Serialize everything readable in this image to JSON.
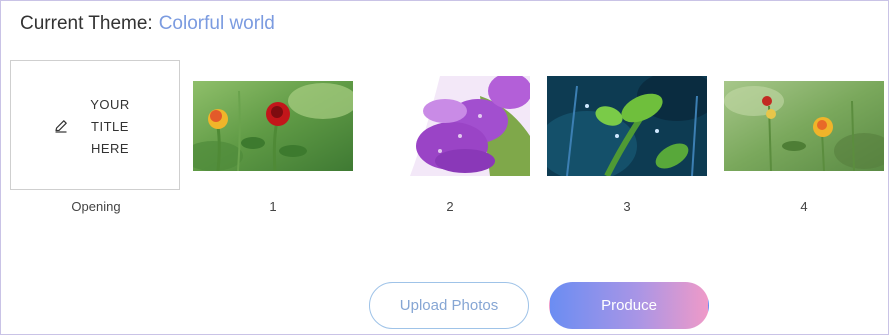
{
  "header": {
    "label": "Current Theme:",
    "theme_name": "Colorful world"
  },
  "opening": {
    "title_placeholder": "YOUR\nTITLE\nHERE",
    "caption": "Opening",
    "icon": "pencil-icon"
  },
  "photos": [
    {
      "caption": "1",
      "subject": "yellow and red roses"
    },
    {
      "caption": "2",
      "subject": "purple tulips with droplets"
    },
    {
      "caption": "3",
      "subject": "green buds with dew"
    },
    {
      "caption": "4",
      "subject": "roses in garden"
    }
  ],
  "actions": {
    "upload_label": "Upload Photos",
    "produce_label": "Produce"
  },
  "colors": {
    "accent": "#7b9be0",
    "upload_border": "#9fc3e8",
    "produce_gradient": [
      "#6b8df2",
      "#a895e6",
      "#ef9ac8"
    ],
    "frame_border": "#c9c3e6"
  }
}
